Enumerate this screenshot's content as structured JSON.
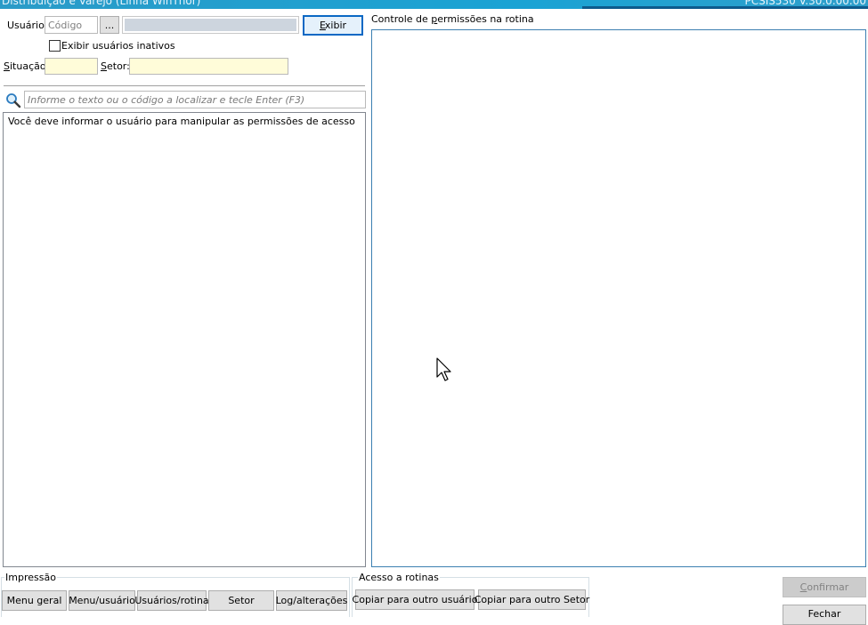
{
  "window": {
    "title": "Distribuição e Varejo (Linha WinThor)",
    "version": "PCSIS530 V.30.0.00.00"
  },
  "filters": {
    "usuario_label": "Usuário:",
    "usuario_code_placeholder": "Código",
    "browse_label": "...",
    "usuario_name_value": "",
    "exibir_label": "Exibir",
    "inativos_label": "Exibir usuários inativos",
    "inativos_checked": false,
    "situacao_label": "Situação:",
    "situacao_value": "",
    "setor_label": "Setor:",
    "setor_value": ""
  },
  "search": {
    "icon": "magnifier-icon",
    "placeholder": "Informe o texto ou o código a localizar e tecle Enter (F3)"
  },
  "tree": {
    "message": "Você deve informar o usuário para manipular as permissões de acesso"
  },
  "permissions": {
    "title": "Controle de permissões na rotina"
  },
  "impressao": {
    "title": "Impressão",
    "buttons": [
      "Menu geral",
      "Menu/usuário",
      "Usuários/rotina",
      "Setor",
      "Log/alterações"
    ]
  },
  "acesso": {
    "title": "Acesso a rotinas",
    "buttons": [
      "Copiar para outro usuário",
      "Copiar para outro Setor"
    ]
  },
  "actions": {
    "confirmar_label": "Confirmar",
    "fechar_label": "Fechar"
  },
  "colors": {
    "titlebar": "#1aa3d4",
    "field_yellow": "#fffcd9",
    "accent": "#0a68c4"
  }
}
